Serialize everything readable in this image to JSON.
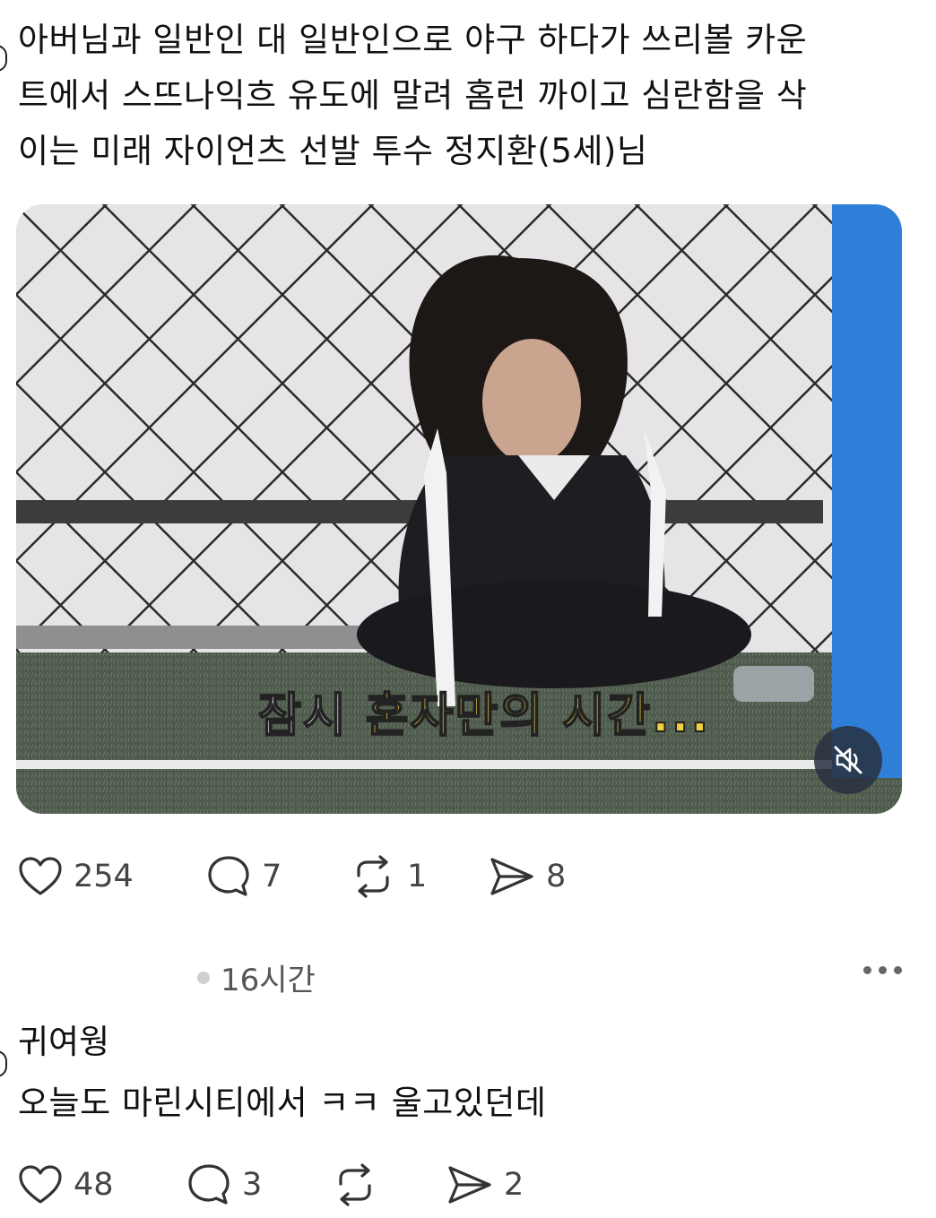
{
  "post": {
    "text": "아버님과 일반인 대 일반인으로 야구 하다가 쓰리볼 카운\n트에서 스뜨나익흐 유도에 말려 홈런 까이고 심란함을 삭\n이는 미래 자이언츠 선발 투수 정지환(5세)님",
    "media": {
      "subtitle_part1": "잠시 ",
      "subtitle_part2": "혼자만의 시간...",
      "mute_icon": "speaker-muted-icon"
    },
    "actions": {
      "likes": "254",
      "replies": "7",
      "reposts": "1",
      "shares": "8"
    }
  },
  "reply_meta": {
    "time": "16시간"
  },
  "reply": {
    "title": "귀여웡",
    "body": "오늘도 마린시티에서 ㅋㅋ 울고있던데",
    "actions": {
      "likes": "48",
      "replies": "3",
      "reposts": "",
      "shares": "2"
    }
  },
  "colors": {
    "text": "#111111",
    "muted": "#444444",
    "goal_post": "#2f7fd8",
    "subtitle_yellow": "#f2d23c"
  }
}
